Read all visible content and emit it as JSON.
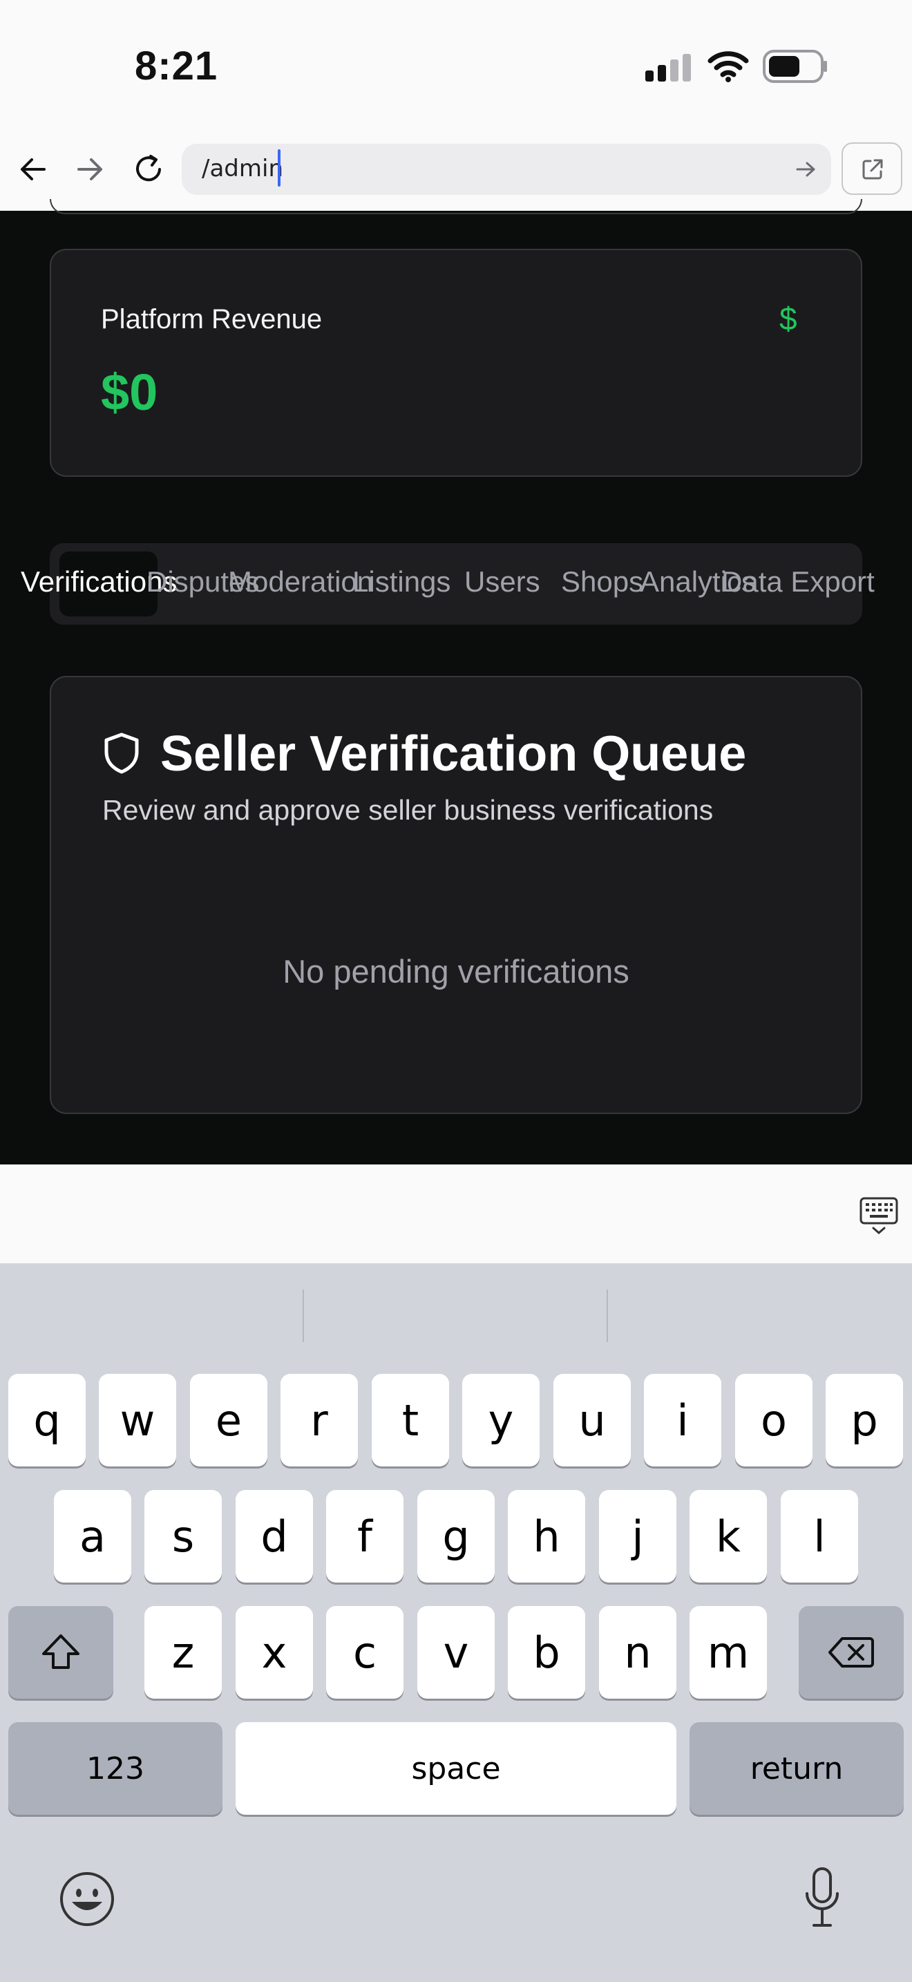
{
  "status_bar": {
    "time": "8:21"
  },
  "browser": {
    "url": "/admin"
  },
  "revenue_card": {
    "title": "Platform Revenue",
    "value": "$0",
    "icon": "$"
  },
  "tabs": [
    {
      "label": "Verifications",
      "active": true
    },
    {
      "label": "Disputes",
      "active": false
    },
    {
      "label": "Moderation",
      "active": false
    },
    {
      "label": "Listings",
      "active": false
    },
    {
      "label": "Users",
      "active": false
    },
    {
      "label": "Shops",
      "active": false
    },
    {
      "label": "Analytics",
      "active": false
    },
    {
      "label": "Data Export",
      "active": false
    }
  ],
  "verification_card": {
    "title": "Seller Verification Queue",
    "subtitle": "Review and approve seller business verifications",
    "empty_text": "No pending verifications"
  },
  "keyboard": {
    "row1": [
      "q",
      "w",
      "e",
      "r",
      "t",
      "y",
      "u",
      "i",
      "o",
      "p"
    ],
    "row2": [
      "a",
      "s",
      "d",
      "f",
      "g",
      "h",
      "j",
      "k",
      "l"
    ],
    "row3": [
      "z",
      "x",
      "c",
      "v",
      "b",
      "n",
      "m"
    ],
    "numbers_label": "123",
    "space_label": "space",
    "return_label": "return"
  },
  "colors": {
    "accent_green": "#22c55e",
    "app_background": "#0b0c0c",
    "card_background": "#1b1b1d",
    "cursor": "#3b66f5"
  }
}
